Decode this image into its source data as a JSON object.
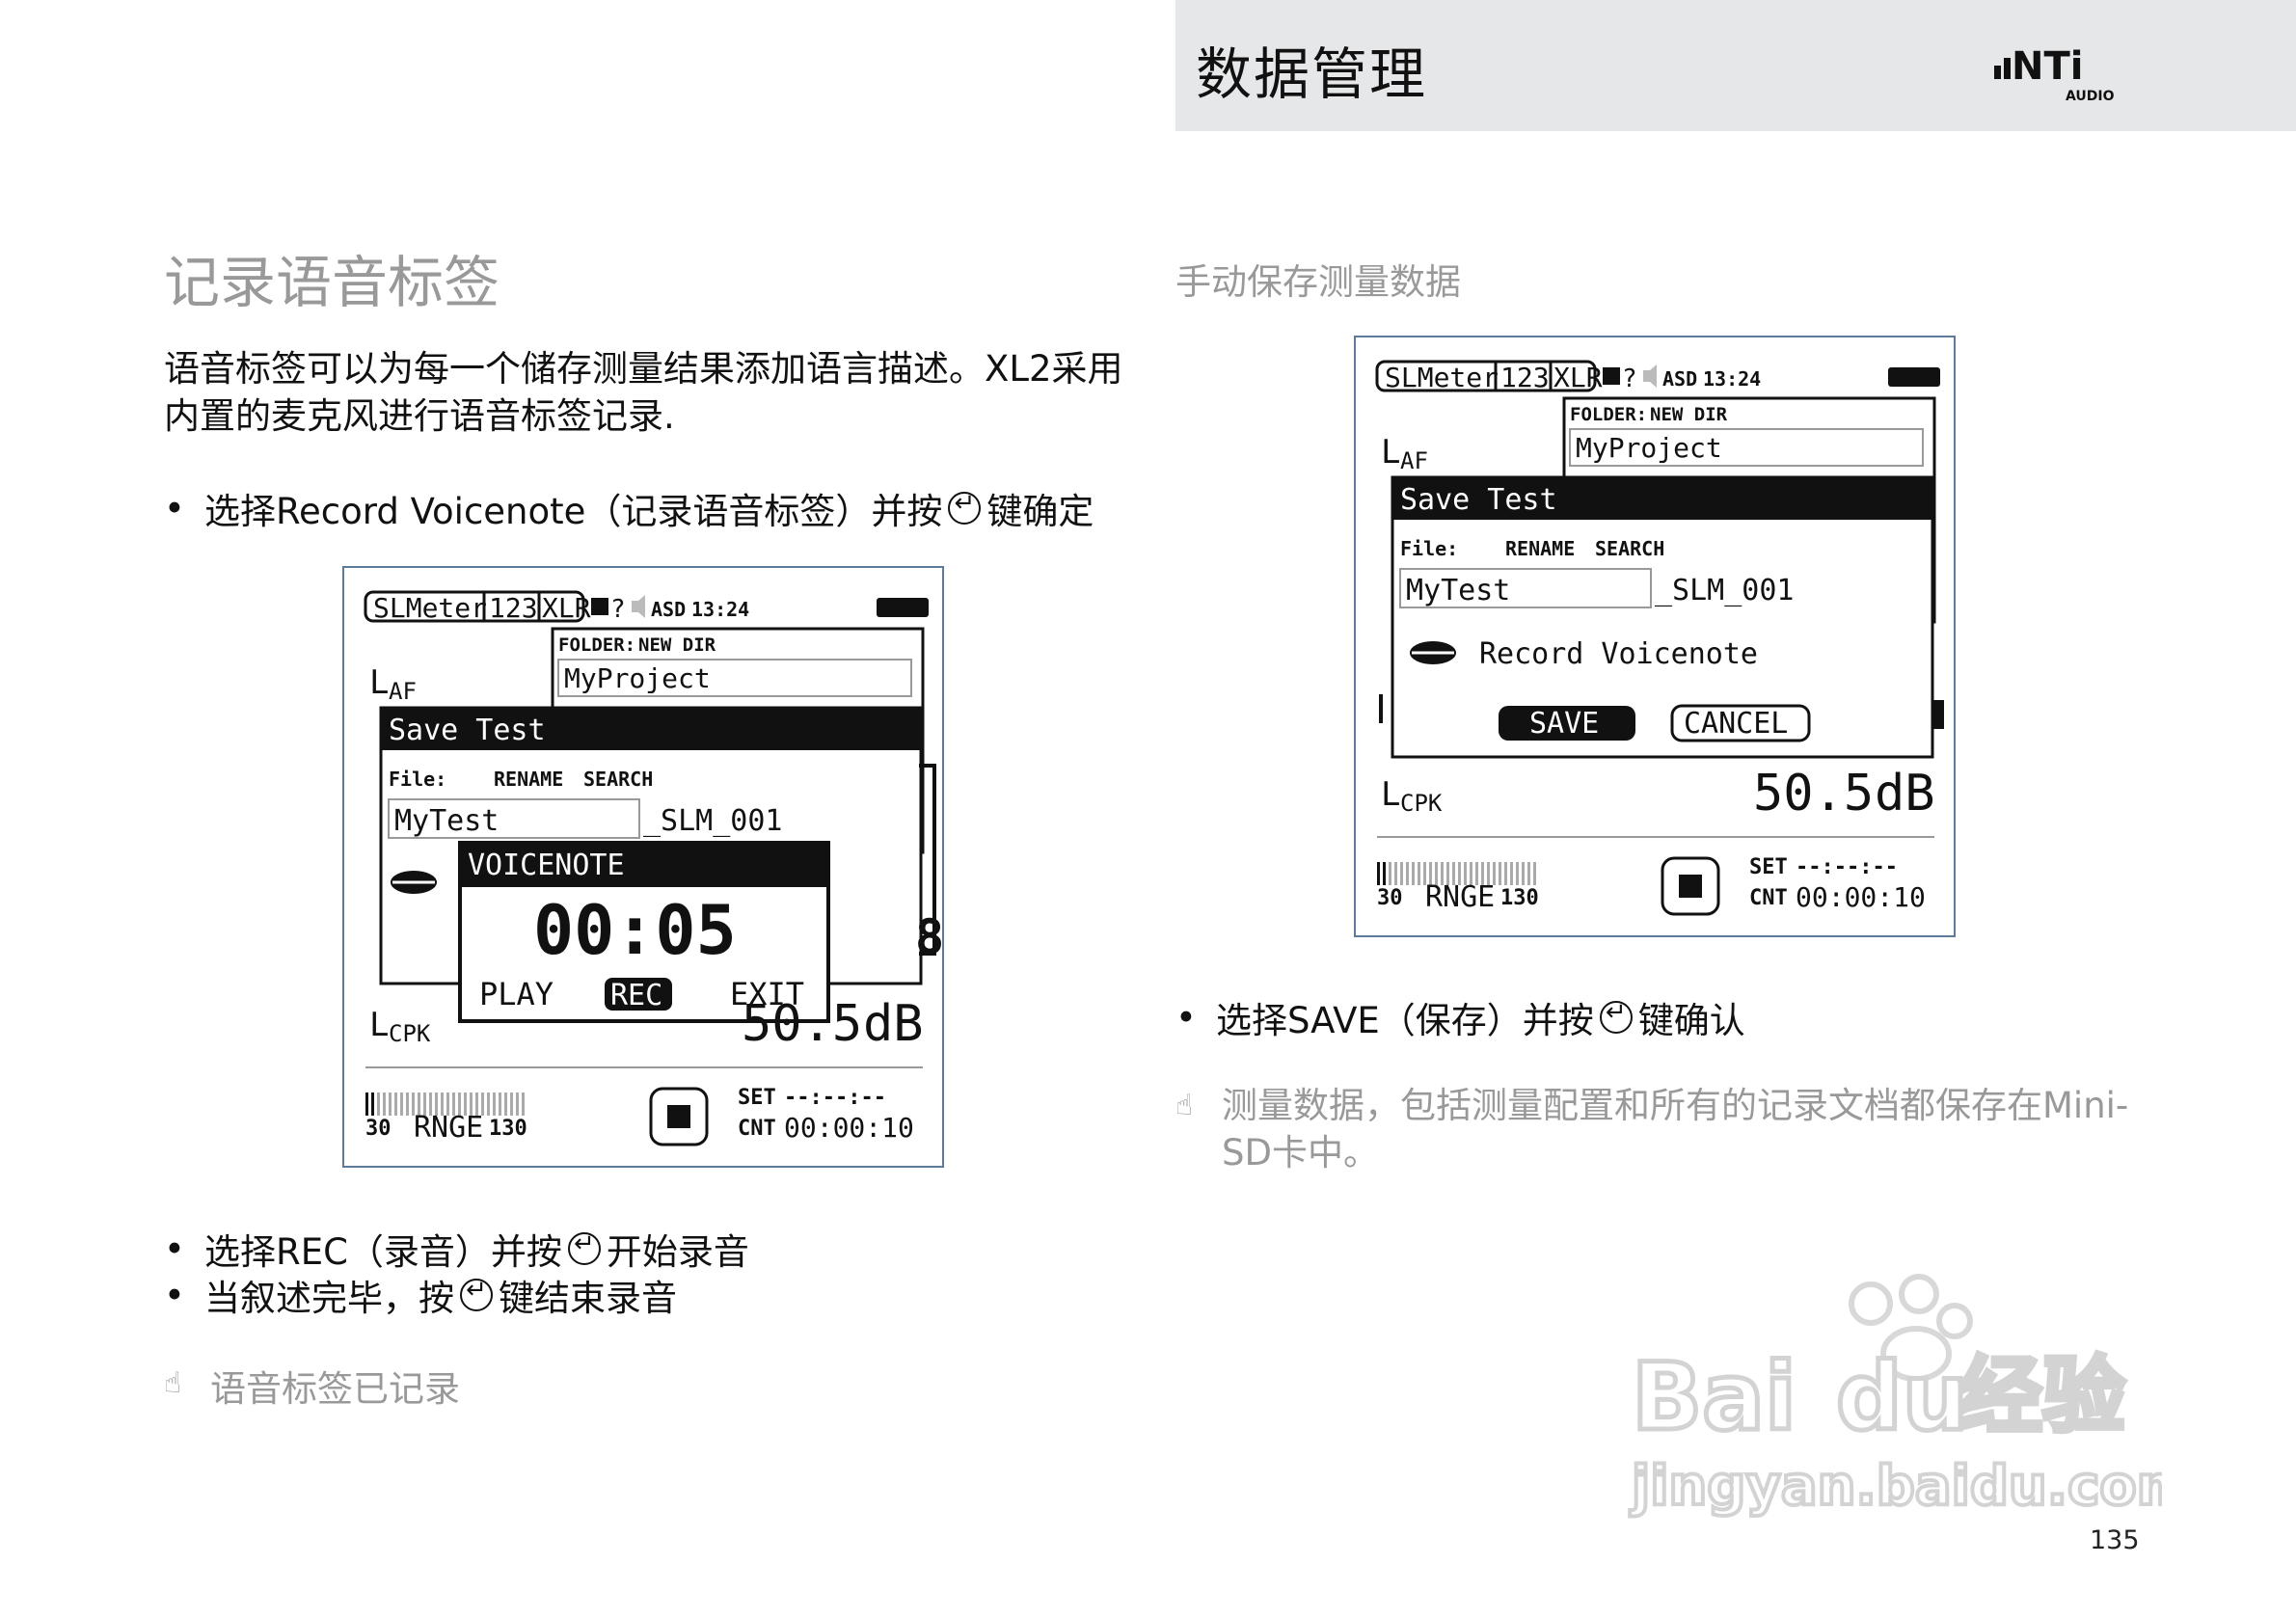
{
  "header": {
    "title": "数据管理",
    "logo_text": "NTi",
    "logo_sub": "AUDIO"
  },
  "left": {
    "section_title": "记录语音标签",
    "intro_line1": "语音标签可以为每一个储存测量结果添加语言描述。XL2采用",
    "intro_line2": "内置的麦克风进行语音标签记录.",
    "bullet1_a": "选择Record Voicenote（记录语音标签）并按",
    "bullet1_b": "键确定",
    "bullet2_a": "选择REC（录音）并按",
    "bullet2_b": "开始录音",
    "bullet3_a": "当叙述完毕，按",
    "bullet3_b": "键结束录音",
    "note": "语音标签已记录"
  },
  "right": {
    "section_title": "手动保存测量数据",
    "bullet_a": "选择SAVE（保存）并按",
    "bullet_b": "键确认",
    "note_line1": "测量数据，包括测量配置和所有的记录文档都保存在Mini-",
    "note_line2": "SD卡中。"
  },
  "device": {
    "tab_slmeter": "SLMeter",
    "tab_123": "123",
    "tab_xlr": "XLR",
    "tab_help": "?",
    "asd": "ASD",
    "time": "13:24",
    "folder_label": "FOLDER:",
    "folder_new_dir": "NEW DIR",
    "folder_value": "MyProject",
    "laf": "L",
    "laf_sub": "AF",
    "dialog_title": "Save Test",
    "file_label": "File:",
    "rename": "RENAME",
    "search": "SEARCH",
    "file_value": "MyTest",
    "file_suffix": "_SLM_001",
    "record_voicenote": "Record Voicenote",
    "save_btn": "SAVE",
    "cancel_btn": "CANCEL",
    "lcpk": "L",
    "lcpk_sub": "CPK",
    "level_value": "50.5",
    "level_unit": "dB",
    "level_partial": "50.5",
    "range_low": "30",
    "range_label": "RNGE",
    "range_high": "130",
    "set_label": "SET",
    "set_value": "--:--:--",
    "cnt_label": "CNT",
    "cnt_value": "00:00:10",
    "voicenote_title": "VOICENOTE",
    "voicenote_timer": "00:05",
    "play": "PLAY",
    "rec": "REC",
    "exit": "EXIT"
  },
  "watermark": {
    "brand_a": "Bai",
    "brand_b": "du",
    "brand_cn": "经验",
    "url": "jingyan.baidu.com"
  },
  "page_number": "135"
}
